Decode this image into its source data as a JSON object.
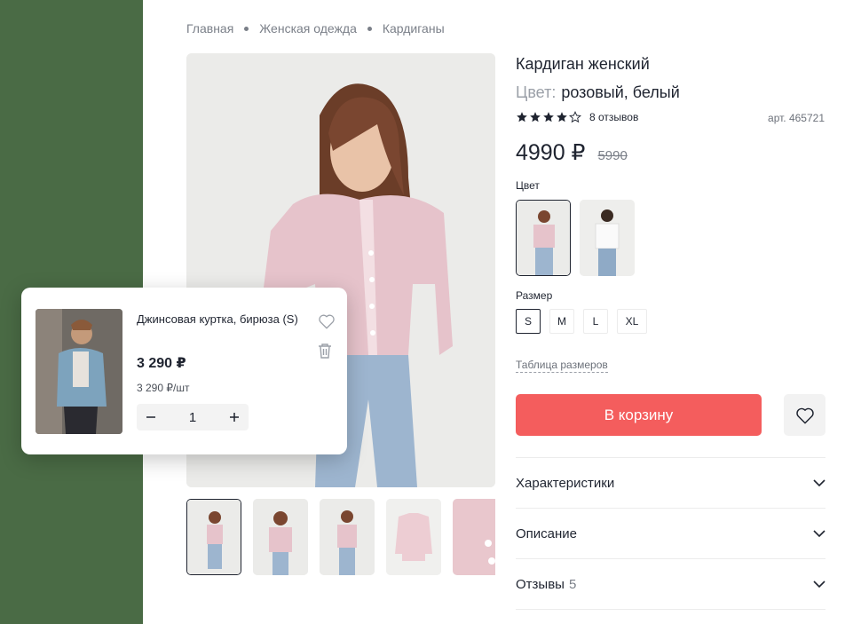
{
  "breadcrumb": [
    "Главная",
    "Женская одежда",
    "Кардиганы"
  ],
  "product": {
    "title": "Кардиган женский",
    "color_label": "Цвет:",
    "color_value": "розовый, белый",
    "rating": 4,
    "rating_max": 5,
    "reviews": "8 отзывов",
    "article": "арт. 465721",
    "price": "4990 ₽",
    "old_price": "5990"
  },
  "color_section": {
    "label": "Цвет",
    "options": [
      "pink",
      "white"
    ]
  },
  "size_section": {
    "label": "Размер",
    "sizes": [
      "S",
      "M",
      "L",
      "XL"
    ],
    "selected": "S",
    "table_link": "Таблица размеров"
  },
  "cart_button": "В корзину",
  "accordion": [
    {
      "label": "Характеристики",
      "count": ""
    },
    {
      "label": "Описание",
      "count": ""
    },
    {
      "label": "Отзывы",
      "count": "5"
    }
  ],
  "cart_item": {
    "name": "Джинсовая куртка, бирюза (S)",
    "price": "3 290 ₽",
    "unit_price": "3 290 ₽/шт",
    "quantity": "1"
  },
  "colors": {
    "accent": "#f45d5d",
    "text": "#1f2430",
    "muted": "#7a7f88",
    "side": "#4a6b45"
  },
  "icons": [
    "star-icon",
    "heart-icon",
    "chevron-down-icon",
    "trash-icon",
    "minus-icon",
    "plus-icon"
  ]
}
